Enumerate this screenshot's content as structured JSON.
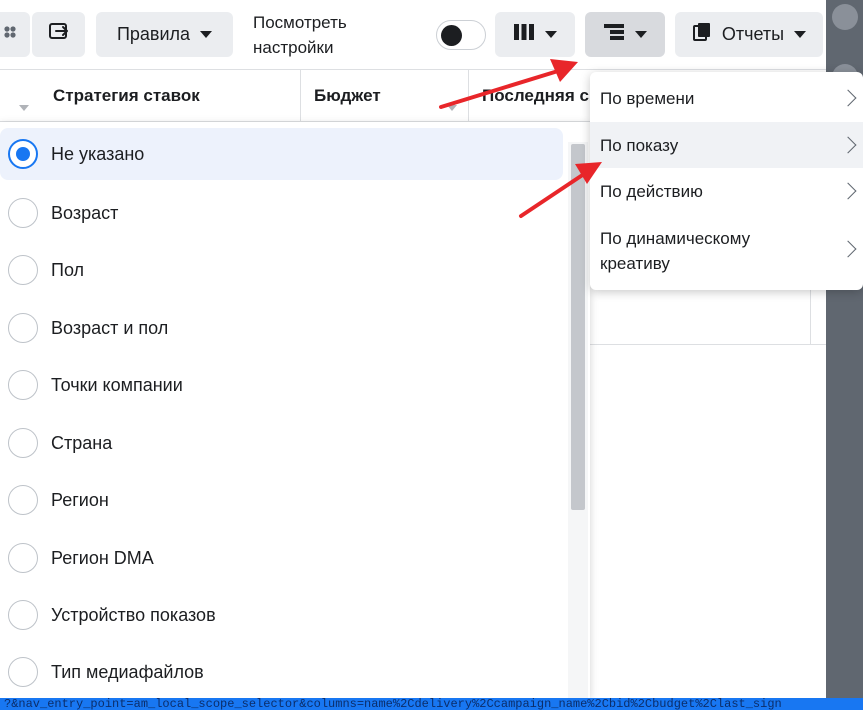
{
  "toolbar": {
    "rules_label": "Правила",
    "view_settings_line1": "Посмотреть",
    "view_settings_line2": "настройки",
    "reports_label": "Отчеты",
    "icons": {
      "audience": "people-icon",
      "export": "export-icon",
      "columns": "columns-icon",
      "breakdown": "breakdown-icon",
      "reports": "reports-icon"
    },
    "view_settings_toggle": "off"
  },
  "table": {
    "headers": [
      {
        "label": "Стратегия ставок"
      },
      {
        "label": "Бюджет"
      },
      {
        "label": "Последняя с"
      }
    ]
  },
  "breakdown_list": {
    "selected_index": 0,
    "items": [
      {
        "label": "Не указано"
      },
      {
        "label": "Возраст"
      },
      {
        "label": "Пол"
      },
      {
        "label": "Возраст и пол"
      },
      {
        "label": "Точки компании"
      },
      {
        "label": "Страна"
      },
      {
        "label": "Регион"
      },
      {
        "label": "Регион DMA"
      },
      {
        "label": "Устройство показов"
      },
      {
        "label": "Тип медиафайлов"
      }
    ]
  },
  "submenu": {
    "hover_index": 1,
    "items": [
      {
        "label": "По времени",
        "label2": ""
      },
      {
        "label": "По показу",
        "label2": ""
      },
      {
        "label": "По действию",
        "label2": ""
      },
      {
        "label": "По динамическому",
        "label2": "креативу"
      }
    ]
  },
  "status_url": "?&nav_entry_point=am_local_scope_selector&columns=name%2Cdelivery%2Ccampaign_name%2Cbid%2Cbudget%2Clast_sign",
  "colors": {
    "accent": "#1877f2",
    "selected_bg": "#edf2fc",
    "arrow": "#e8262a",
    "strip": "#606770"
  }
}
